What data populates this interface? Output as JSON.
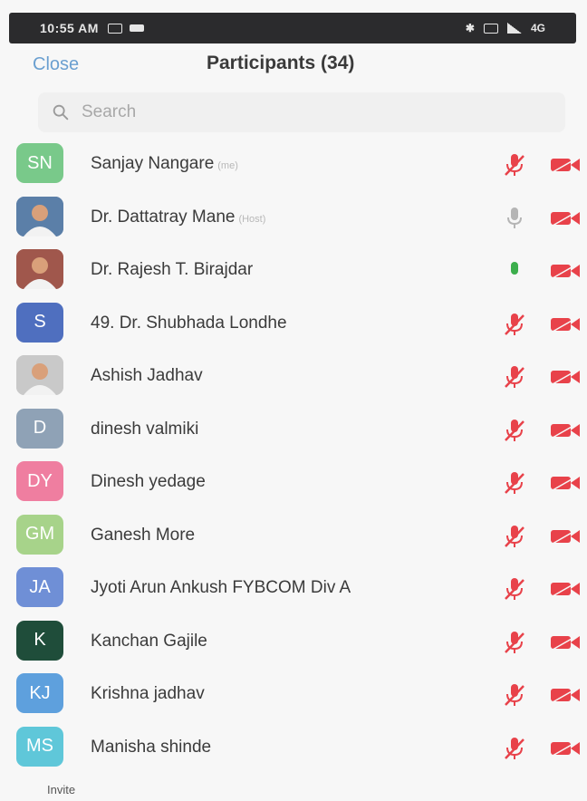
{
  "status_bar": {
    "time": "10:55 AM",
    "right_text": "4G"
  },
  "header": {
    "close_label": "Close",
    "title": "Participants (34)"
  },
  "search": {
    "placeholder": "Search"
  },
  "participants": [
    {
      "initials": "SN",
      "name": "Sanjay Nangare",
      "role": "(me)",
      "color": "#79c98a",
      "photo": false,
      "mic": "muted",
      "video": "off"
    },
    {
      "initials": "",
      "name": "Dr. Dattatray Mane",
      "role": "(Host)",
      "color": "#5b7fa8",
      "photo": true,
      "mic": "idle",
      "video": "off"
    },
    {
      "initials": "",
      "name": "Dr. Rajesh T. Birajdar",
      "role": "",
      "color": "#a0574c",
      "photo": true,
      "mic": "active",
      "video": "off"
    },
    {
      "initials": "S",
      "name": "49. Dr. Shubhada Londhe",
      "role": "",
      "color": "#4f6fbf",
      "photo": false,
      "mic": "muted",
      "video": "off"
    },
    {
      "initials": "",
      "name": "Ashish Jadhav",
      "role": "",
      "color": "#c9c9c9",
      "photo": true,
      "mic": "muted",
      "video": "off"
    },
    {
      "initials": "D",
      "name": "dinesh valmiki",
      "role": "",
      "color": "#8fa2b6",
      "photo": false,
      "mic": "muted",
      "video": "off"
    },
    {
      "initials": "DY",
      "name": "Dinesh yedage",
      "role": "",
      "color": "#ef7ea0",
      "photo": false,
      "mic": "muted",
      "video": "off"
    },
    {
      "initials": "GM",
      "name": "Ganesh More",
      "role": "",
      "color": "#a7d38a",
      "photo": false,
      "mic": "muted",
      "video": "off"
    },
    {
      "initials": "JA",
      "name": "Jyoti Arun Ankush FYBCOM Div A",
      "role": "",
      "color": "#6f8fd6",
      "photo": false,
      "mic": "muted",
      "video": "off"
    },
    {
      "initials": "K",
      "name": "Kanchan Gajile",
      "role": "",
      "color": "#1f4d3a",
      "photo": false,
      "mic": "muted",
      "video": "off"
    },
    {
      "initials": "KJ",
      "name": "Krishna jadhav",
      "role": "",
      "color": "#5ea0dd",
      "photo": false,
      "mic": "muted",
      "video": "off"
    },
    {
      "initials": "MS",
      "name": "Manisha shinde",
      "role": "",
      "color": "#5fc7d9",
      "photo": false,
      "mic": "muted",
      "video": "off"
    }
  ],
  "footer": {
    "invite_label": "Invite"
  },
  "colors": {
    "accent": "#6a9fd0",
    "muted_red": "#e8424a",
    "active_green": "#3cae4c",
    "idle_gray": "#b5b5b5"
  }
}
